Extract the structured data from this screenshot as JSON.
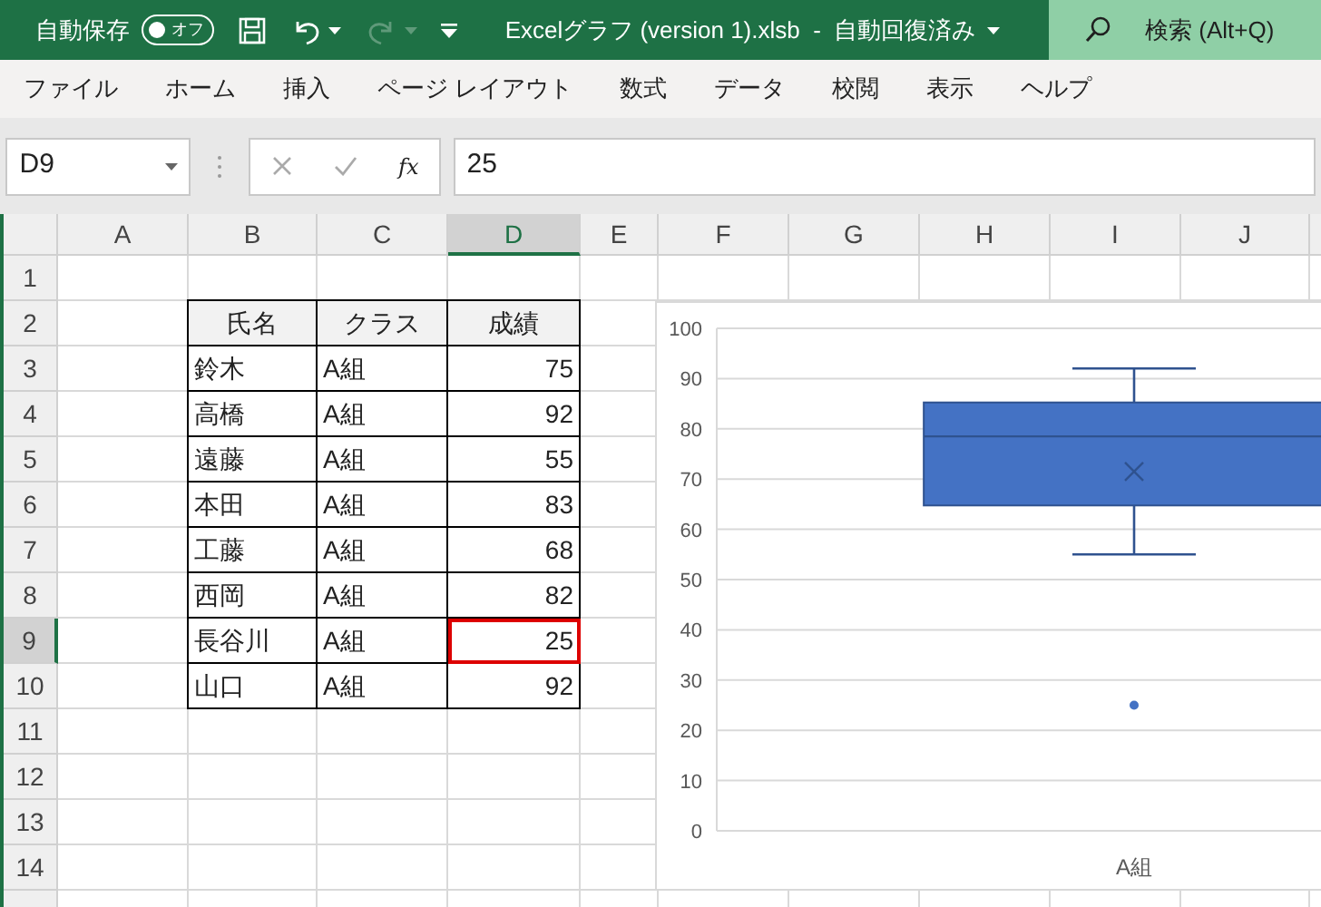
{
  "title_bar": {
    "autosave_label": "自動保存",
    "autosave": {
      "on": false,
      "label": "オフ"
    },
    "quick_access": [
      {
        "kind": "save",
        "disabled": false
      },
      {
        "kind": "undo",
        "disabled": false
      },
      {
        "kind": "redo",
        "disabled": true
      },
      {
        "kind": "customize",
        "disabled": false
      }
    ],
    "title": "Excelグラフ (version 1).xlsb  -  自動回復済み",
    "search": {
      "placeholder": "検索 (Alt+Q)"
    }
  },
  "ribbon_tabs": [
    "ファイル",
    "ホーム",
    "挿入",
    "ページ レイアウト",
    "数式",
    "データ",
    "校閲",
    "表示",
    "ヘルプ"
  ],
  "formula_bar": {
    "name_box": "D9",
    "function_button": "fx",
    "value": "25"
  },
  "sheet": {
    "columns": [
      {
        "label": "A",
        "selected": false
      },
      {
        "label": "B",
        "selected": false
      },
      {
        "label": "C",
        "selected": false
      },
      {
        "label": "D",
        "selected": true
      },
      {
        "label": "E",
        "selected": false
      },
      {
        "label": "F",
        "selected": false
      },
      {
        "label": "G",
        "selected": false
      },
      {
        "label": "H",
        "selected": false
      },
      {
        "label": "I",
        "selected": false
      },
      {
        "label": "J",
        "selected": false
      }
    ],
    "rows": [
      {
        "label": "1",
        "selected": false
      },
      {
        "label": "2",
        "selected": false
      },
      {
        "label": "3",
        "selected": false
      },
      {
        "label": "4",
        "selected": false
      },
      {
        "label": "5",
        "selected": false
      },
      {
        "label": "6",
        "selected": false
      },
      {
        "label": "7",
        "selected": false
      },
      {
        "label": "8",
        "selected": false
      },
      {
        "label": "9",
        "selected": true
      },
      {
        "label": "10",
        "selected": false
      },
      {
        "label": "11",
        "selected": false
      },
      {
        "label": "12",
        "selected": false
      },
      {
        "label": "13",
        "selected": false
      },
      {
        "label": "14",
        "selected": false
      }
    ],
    "table": {
      "header": [
        "氏名",
        "クラス",
        "成績"
      ],
      "rows": [
        {
          "name": "鈴木",
          "class": "A組",
          "score": "75",
          "selected": false
        },
        {
          "name": "高橋",
          "class": "A組",
          "score": "92",
          "selected": false
        },
        {
          "name": "遠藤",
          "class": "A組",
          "score": "55",
          "selected": false
        },
        {
          "name": "本田",
          "class": "A組",
          "score": "83",
          "selected": false
        },
        {
          "name": "工藤",
          "class": "A組",
          "score": "68",
          "selected": false
        },
        {
          "name": "西岡",
          "class": "A組",
          "score": "82",
          "selected": false
        },
        {
          "name": "長谷川",
          "class": "A組",
          "score": "25",
          "selected": true
        },
        {
          "name": "山口",
          "class": "A組",
          "score": "92",
          "selected": false
        }
      ]
    },
    "chart": {
      "gridlines": true,
      "axis_labels": [
        "100",
        "90",
        "80",
        "70",
        "60",
        "50",
        "40",
        "30",
        "20",
        "10",
        "0"
      ],
      "category_label": "A組"
    }
  }
}
